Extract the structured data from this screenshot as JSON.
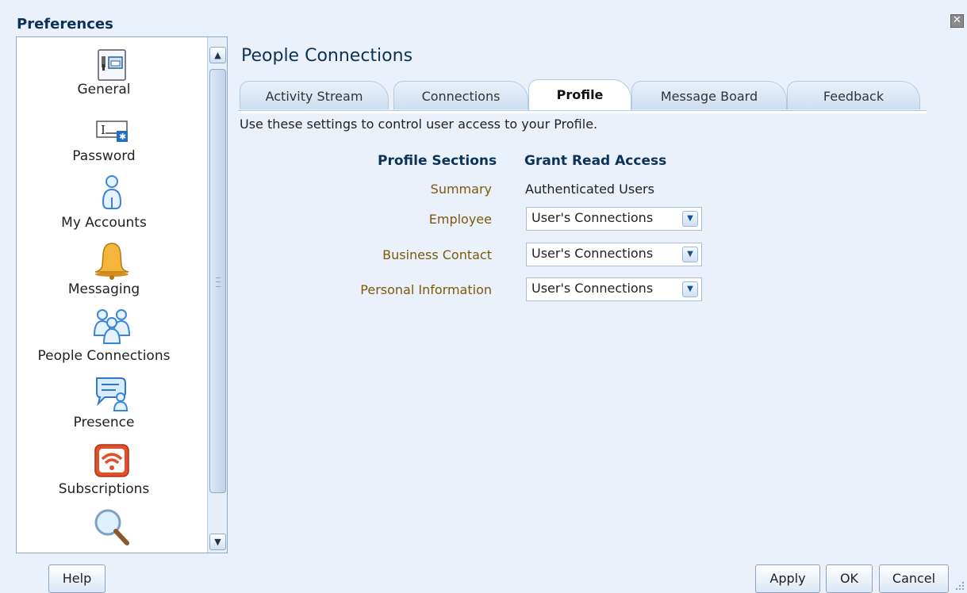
{
  "window": {
    "title": "Preferences",
    "close_glyph": "✕"
  },
  "sidebar": {
    "items": [
      {
        "label": "General",
        "icon": "general-settings-icon"
      },
      {
        "label": "Password",
        "icon": "password-field-icon"
      },
      {
        "label": "My Accounts",
        "icon": "user-account-icon"
      },
      {
        "label": "Messaging",
        "icon": "bell-icon"
      },
      {
        "label": "People Connections",
        "icon": "people-group-icon"
      },
      {
        "label": "Presence",
        "icon": "presence-chat-icon"
      },
      {
        "label": "Subscriptions",
        "icon": "rss-feed-icon"
      },
      {
        "label": "",
        "icon": "search-magnifier-icon"
      }
    ]
  },
  "main": {
    "title": "People Connections",
    "tabs": [
      {
        "label": "Activity Stream",
        "active": false
      },
      {
        "label": "Connections",
        "active": false
      },
      {
        "label": "Profile",
        "active": true
      },
      {
        "label": "Message Board",
        "active": false
      },
      {
        "label": "Feedback",
        "active": false
      }
    ],
    "description": "Use these settings to control user access to your Profile.",
    "table": {
      "headers": {
        "sections": "Profile Sections",
        "access": "Grant Read Access"
      },
      "rows": [
        {
          "section": "Summary",
          "access": "Authenticated Users",
          "editable": false
        },
        {
          "section": "Employee",
          "access": "User's Connections",
          "editable": true
        },
        {
          "section": "Business Contact",
          "access": "User's Connections",
          "editable": true
        },
        {
          "section": "Personal Information",
          "access": "User's Connections",
          "editable": true
        }
      ]
    }
  },
  "footer": {
    "help": "Help",
    "apply": "Apply",
    "ok": "OK",
    "cancel": "Cancel"
  },
  "colors": {
    "title": "#0d3259",
    "section_label": "#7b5a0a",
    "background": "#eaf1fa"
  }
}
